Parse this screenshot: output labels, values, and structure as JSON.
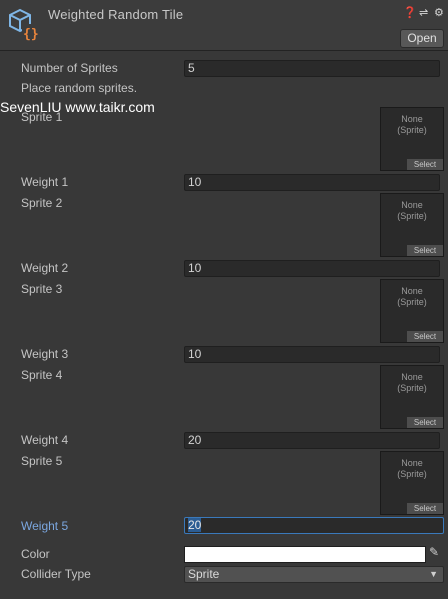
{
  "header": {
    "title": "Weighted Random Tile",
    "open_label": "Open",
    "icons": [
      "help-icon",
      "presets-icon",
      "settings-icon"
    ]
  },
  "watermark": "SevenLIU www.taikr.com",
  "number_of_sprites": {
    "label": "Number of Sprites",
    "value": "5"
  },
  "hint": "Place random sprites.",
  "sprite_slot": {
    "none_text": "None\n(Sprite)",
    "select_label": "Select"
  },
  "entries": [
    {
      "sprite_label": "Sprite 1",
      "weight_label": "Weight 1",
      "weight": "10"
    },
    {
      "sprite_label": "Sprite 2",
      "weight_label": "Weight 2",
      "weight": "10"
    },
    {
      "sprite_label": "Sprite 3",
      "weight_label": "Weight 3",
      "weight": "10"
    },
    {
      "sprite_label": "Sprite 4",
      "weight_label": "Weight 4",
      "weight": "20"
    },
    {
      "sprite_label": "Sprite 5",
      "weight_label": "Weight 5",
      "weight": "20"
    }
  ],
  "color": {
    "label": "Color",
    "value": "#ffffff"
  },
  "collider_type": {
    "label": "Collider Type",
    "value": "Sprite"
  },
  "accent_color": "#3a79bb"
}
